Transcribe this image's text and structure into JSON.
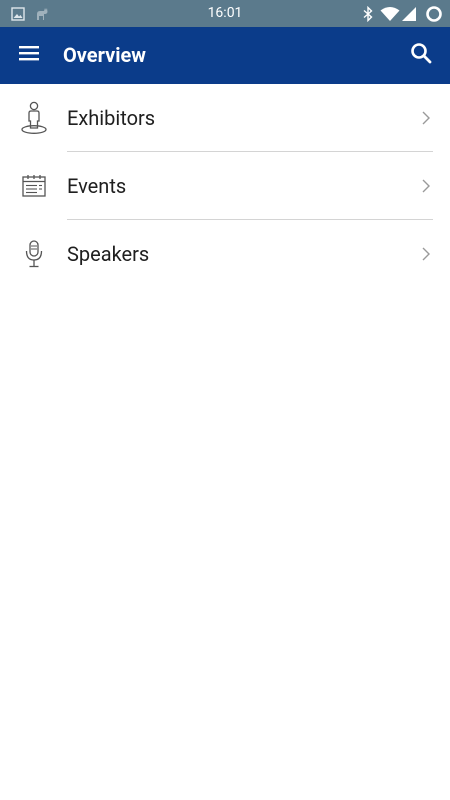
{
  "status_bar": {
    "time": "16:01",
    "left_icons": [
      "image-icon",
      "cat-icon"
    ],
    "right_icons": [
      "bluetooth-icon",
      "wifi-icon",
      "signal-icon",
      "sync-ring-icon"
    ],
    "background": "#5b7a8c"
  },
  "app_bar": {
    "title": "Overview",
    "background": "#0b3c8a",
    "menu_icon": "hamburger-menu-icon",
    "search_icon": "search-icon"
  },
  "list": {
    "items": [
      {
        "label": "Exhibitors",
        "icon": "exhibitor-person-icon"
      },
      {
        "label": "Events",
        "icon": "calendar-icon"
      },
      {
        "label": "Speakers",
        "icon": "microphone-icon"
      }
    ]
  }
}
